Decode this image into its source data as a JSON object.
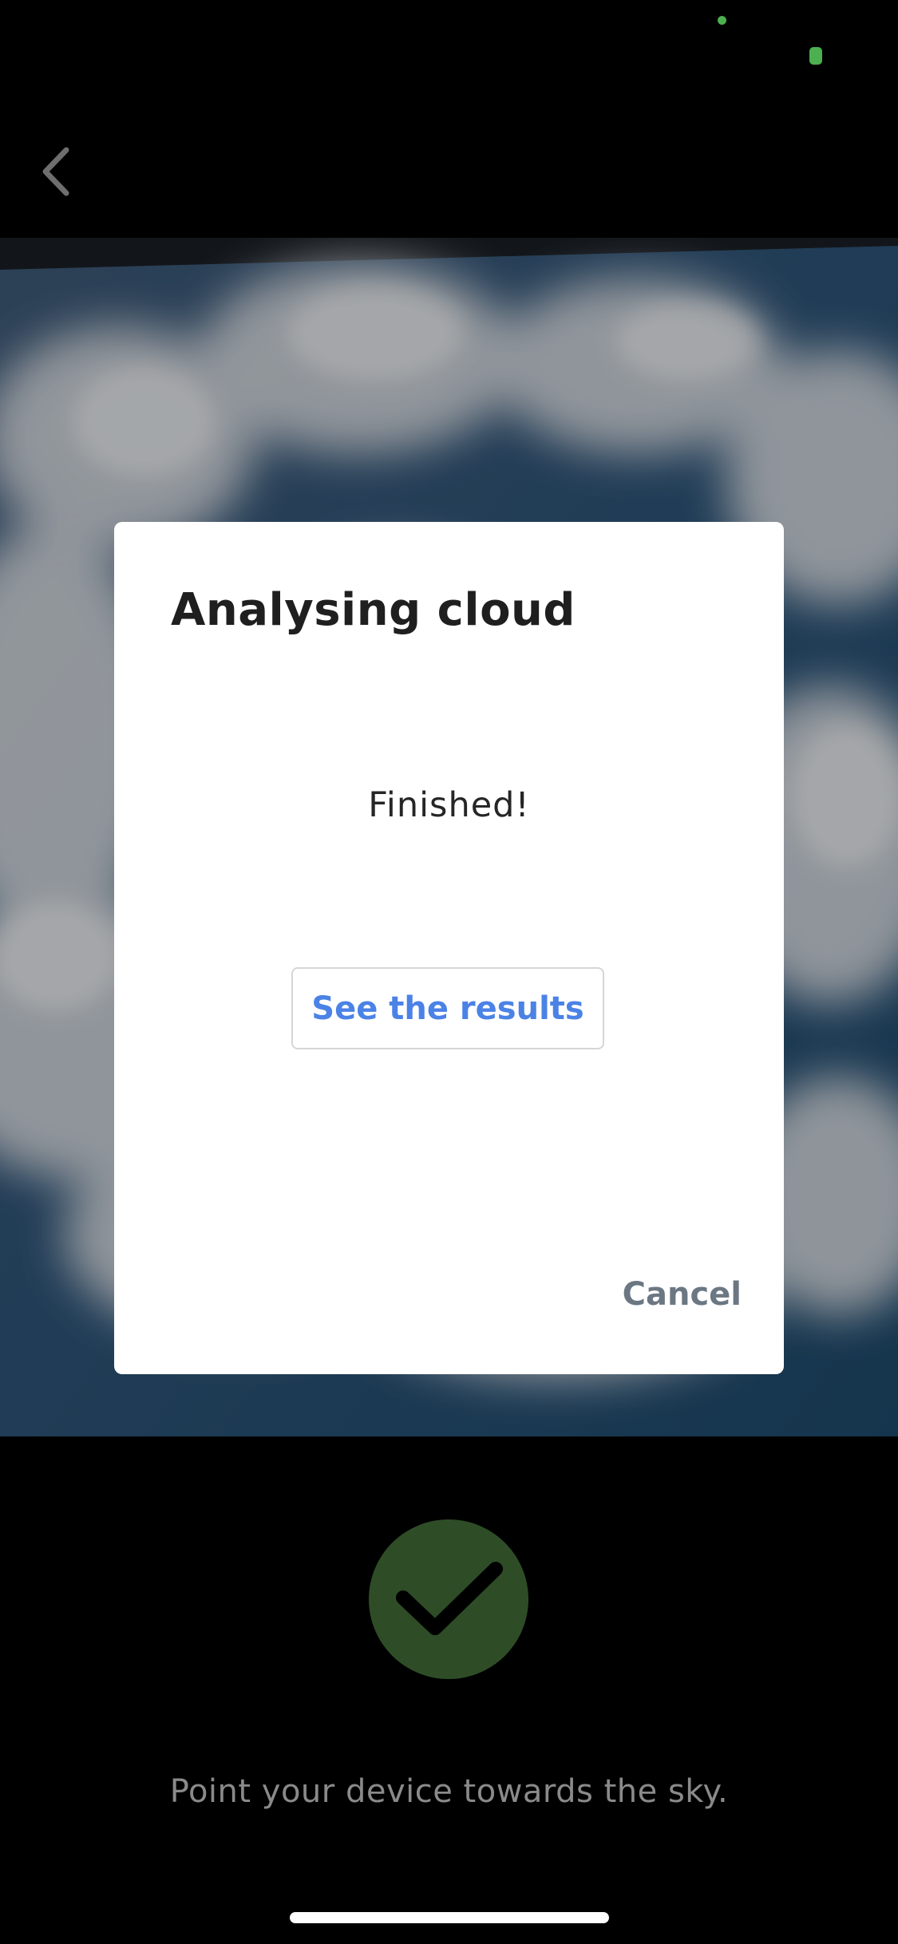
{
  "status_bar": {
    "indicator_color": "#4caf50",
    "indicator_icon": "camera-in-use-dot",
    "battery_icon": "battery-icon"
  },
  "navigation": {
    "back_icon": "chevron-left-icon"
  },
  "camera": {
    "description_icon": "sky-camera-preview"
  },
  "dialog": {
    "title": "Analysing cloud",
    "status": "Finished!",
    "results_button_label": "See the results",
    "cancel_label": "Cancel"
  },
  "capture": {
    "icon": "checkmark-icon",
    "color": "#2e4d27"
  },
  "hint": "Point your device towards the sky.",
  "colors": {
    "accent": "#4b82e6",
    "cancel": "#6b7782"
  }
}
